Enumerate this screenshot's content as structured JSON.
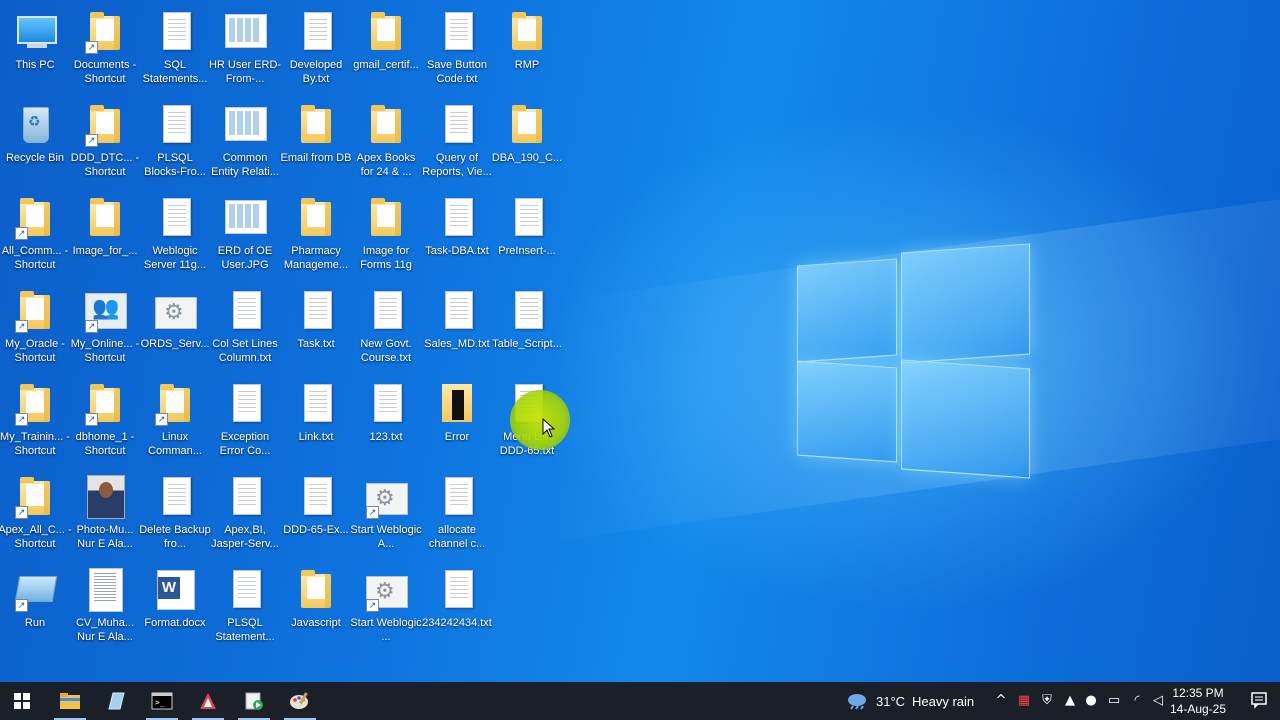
{
  "desktop": {
    "icons": [
      {
        "label": "This PC",
        "type": "pc",
        "shortcut": false
      },
      {
        "label": "Documents - Shortcut",
        "type": "folder",
        "shortcut": true
      },
      {
        "label": "SQL Statements...",
        "type": "doc",
        "shortcut": false
      },
      {
        "label": "HR User ERD-From-...",
        "type": "image",
        "shortcut": false
      },
      {
        "label": "Developed By.txt",
        "type": "doc",
        "shortcut": false
      },
      {
        "label": "gmail_certif...",
        "type": "folder",
        "shortcut": false
      },
      {
        "label": "Save Button Code.txt",
        "type": "doc",
        "shortcut": false
      },
      {
        "label": "RMP",
        "type": "folder",
        "shortcut": false
      },
      {
        "label": "Recycle Bin",
        "type": "bin",
        "shortcut": false
      },
      {
        "label": "DDD_DTC... - Shortcut",
        "type": "folder",
        "shortcut": true
      },
      {
        "label": "PLSQL Blocks-Fro...",
        "type": "doc",
        "shortcut": false
      },
      {
        "label": "Common Entity Relati...",
        "type": "image",
        "shortcut": false
      },
      {
        "label": "Email from DB",
        "type": "folder",
        "shortcut": false
      },
      {
        "label": "Apex Books for 24 & ...",
        "type": "folder",
        "shortcut": false
      },
      {
        "label": "Query of Reports, Vie...",
        "type": "doc",
        "shortcut": false
      },
      {
        "label": "DBA_190_C...",
        "type": "folder",
        "shortcut": false
      },
      {
        "label": "All_Comm... - Shortcut",
        "type": "folder",
        "shortcut": true
      },
      {
        "label": "Image_for_...",
        "type": "folder",
        "shortcut": false
      },
      {
        "label": "Weblogic Server 11g...",
        "type": "doc",
        "shortcut": false
      },
      {
        "label": "ERD of OE User.JPG",
        "type": "image",
        "shortcut": false
      },
      {
        "label": "Pharmacy Manageme...",
        "type": "folder",
        "shortcut": false
      },
      {
        "label": "Image for Forms 11g",
        "type": "folder",
        "shortcut": false
      },
      {
        "label": "Task-DBA.txt",
        "type": "doc",
        "shortcut": false
      },
      {
        "label": "PreInsert-...",
        "type": "doc",
        "shortcut": false
      },
      {
        "label": "My_Oracle - Shortcut",
        "type": "folder",
        "shortcut": true
      },
      {
        "label": "My_Online... - Shortcut",
        "type": "people",
        "shortcut": true
      },
      {
        "label": "ORDS_Serv...",
        "type": "gear",
        "shortcut": false
      },
      {
        "label": "Col Set Lines Column.txt",
        "type": "doc",
        "shortcut": false
      },
      {
        "label": "Task.txt",
        "type": "doc",
        "shortcut": false
      },
      {
        "label": "New Govt. Course.txt",
        "type": "doc",
        "shortcut": false
      },
      {
        "label": "Sales_MD.txt",
        "type": "doc",
        "shortcut": false
      },
      {
        "label": "Table_Script...",
        "type": "doc",
        "shortcut": false
      },
      {
        "label": "My_Trainin... - Shortcut",
        "type": "folder",
        "shortcut": true
      },
      {
        "label": "dbhome_1 - Shortcut",
        "type": "folder",
        "shortcut": true
      },
      {
        "label": "Linux Comman...",
        "type": "folder",
        "shortcut": true
      },
      {
        "label": "Exception Error Co...",
        "type": "doc",
        "shortcut": false
      },
      {
        "label": "Link.txt",
        "type": "doc",
        "shortcut": false
      },
      {
        "label": "123.txt",
        "type": "doc",
        "shortcut": false
      },
      {
        "label": "Error",
        "type": "errfolder",
        "shortcut": false
      },
      {
        "label": "Menu List DDD-65.txt",
        "type": "doc",
        "shortcut": false
      },
      {
        "label": "Apex_All_C... - Shortcut",
        "type": "folder",
        "shortcut": true
      },
      {
        "label": "Photo-Mu... Nur E Ala...",
        "type": "photo",
        "shortcut": false
      },
      {
        "label": "Delete Backup fro...",
        "type": "doc",
        "shortcut": false
      },
      {
        "label": "Apex,BI, Jasper-Serv...",
        "type": "doc",
        "shortcut": false
      },
      {
        "label": "DDD-65-Ex...",
        "type": "doc",
        "shortcut": false
      },
      {
        "label": "Start Weblogic A...",
        "type": "gear",
        "shortcut": true
      },
      {
        "label": "allocate channel c...",
        "type": "doc",
        "shortcut": false
      },
      {
        "label": "Run",
        "type": "run",
        "shortcut": true
      },
      {
        "label": "CV_Muha... Nur E Ala...",
        "type": "cv",
        "shortcut": false
      },
      {
        "label": "Format.docx",
        "type": "word",
        "shortcut": false
      },
      {
        "label": "PLSQL Statement...",
        "type": "doc",
        "shortcut": false
      },
      {
        "label": "Javascript",
        "type": "folder",
        "shortcut": false
      },
      {
        "label": "Start Weblogic ...",
        "type": "gear",
        "shortcut": true
      },
      {
        "label": "234242434.txt",
        "type": "doc",
        "shortcut": false
      }
    ]
  },
  "taskbar": {
    "apps": [
      {
        "name": "file-explorer",
        "icon": "folder-icon"
      },
      {
        "name": "app-2",
        "icon": "document-icon"
      },
      {
        "name": "terminal",
        "icon": "terminal-icon"
      },
      {
        "name": "app-4",
        "icon": "app-icon"
      },
      {
        "name": "app-5",
        "icon": "app-icon"
      },
      {
        "name": "app-6",
        "icon": "paint-icon"
      }
    ],
    "weather": {
      "temp": "31°C",
      "condition": "Heavy rain"
    },
    "clock": {
      "time": "12:35 PM",
      "date": "14-Aug-25"
    }
  }
}
